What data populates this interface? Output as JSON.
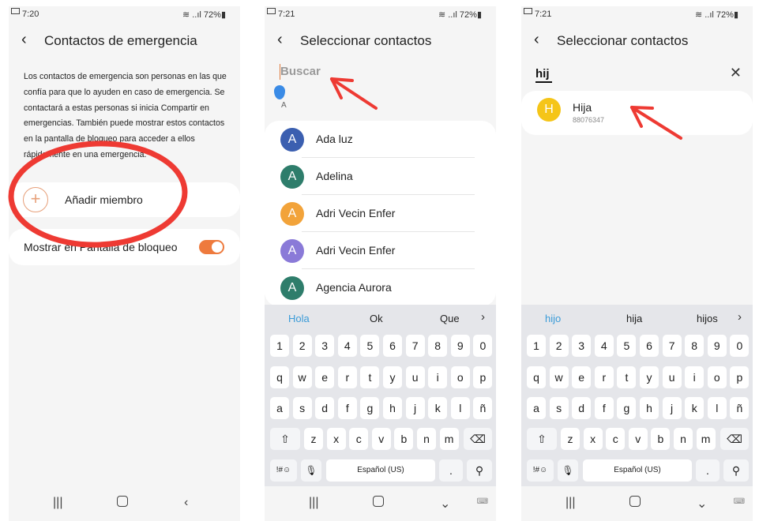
{
  "phone1": {
    "status": {
      "time": "7:20",
      "battery": "72%"
    },
    "title": "Contactos de emergencia",
    "description": "Los contactos de emergencia son personas en las que confía para que lo ayuden en caso de emergencia. Se contactará a estas personas si inicia Compartir en emergencias. También puede mostrar estos contactos en la pantalla de bloqueo para acceder a ellos rápidamente en una emergencia.",
    "add_label": "Añadir miembro",
    "lockscreen_label": "Mostrar en Pantalla de bloqueo",
    "lockscreen_enabled": true
  },
  "phone2": {
    "status": {
      "time": "7:21",
      "battery": "72%"
    },
    "title": "Seleccionar contactos",
    "search_placeholder": "Buscar",
    "index_letter": "A",
    "contacts": [
      {
        "initial": "A",
        "name": "Ada luz",
        "color": "#3b5fb0"
      },
      {
        "initial": "A",
        "name": "Adelina",
        "color": "#2e7d6b"
      },
      {
        "initial": "A",
        "name": "Adri Vecin Enfer",
        "color": "#f2a33a"
      },
      {
        "initial": "A",
        "name": "Adri Vecin Enfer",
        "color": "#8a7ad8"
      },
      {
        "initial": "A",
        "name": "Agencia Aurora",
        "color": "#2e7d6b"
      }
    ],
    "suggestions": [
      "Hola",
      "Ok",
      "Que"
    ]
  },
  "phone3": {
    "status": {
      "time": "7:21",
      "battery": "72%"
    },
    "title": "Seleccionar contactos",
    "query": "hij",
    "result": {
      "initial": "H",
      "name": "Hija",
      "number": "88076347",
      "color": "#f5c518"
    },
    "suggestions": [
      "hijo",
      "hija",
      "hijos"
    ]
  },
  "keyboard": {
    "numbers": [
      "1",
      "2",
      "3",
      "4",
      "5",
      "6",
      "7",
      "8",
      "9",
      "0"
    ],
    "row1": [
      "q",
      "w",
      "e",
      "r",
      "t",
      "y",
      "u",
      "i",
      "o",
      "p"
    ],
    "row2": [
      "a",
      "s",
      "d",
      "f",
      "g",
      "h",
      "j",
      "k",
      "l",
      "ñ"
    ],
    "row3": [
      "z",
      "x",
      "c",
      "v",
      "b",
      "n",
      "m"
    ],
    "symbols_label": "!#☺",
    "space_label": "Español (US)",
    "period": "."
  }
}
